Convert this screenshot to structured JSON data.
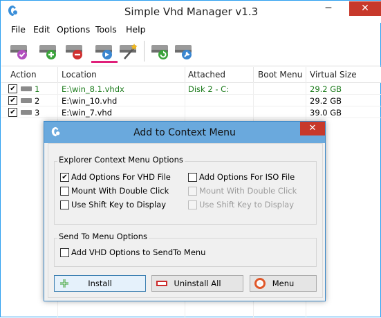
{
  "window": {
    "title": "Simple Vhd Manager v1.3",
    "min_glyph": "─",
    "max_glyph": "☐",
    "close_glyph": "✕"
  },
  "menu": [
    "File",
    "Edit",
    "Options",
    "Tools",
    "Help"
  ],
  "toolbar": {
    "buttons": [
      "mount-vhd",
      "add-vhd",
      "remove-vhd",
      "context-menu",
      "settings-wizard",
      "refresh",
      "tools"
    ],
    "active": "context-menu"
  },
  "list": {
    "columns": [
      "Action",
      "Location",
      "Attached",
      "Boot Menu",
      "Virtual Size"
    ],
    "rows": [
      {
        "num": "1",
        "location": "E:\\win_8.1.vhdx",
        "attached": "Disk 2  -  C:",
        "boot": "",
        "size": "29.2 GB",
        "checked": true,
        "highlight": true
      },
      {
        "num": "2",
        "location": "E:\\win_10.vhd",
        "attached": "",
        "boot": "",
        "size": "29.2 GB",
        "checked": true,
        "highlight": false
      },
      {
        "num": "3",
        "location": "E:\\win_7.vhd",
        "attached": "",
        "boot": "",
        "size": "39.0 GB",
        "checked": true,
        "highlight": false
      }
    ]
  },
  "dialog": {
    "title": "Add to Context Menu",
    "close_glyph": "✕",
    "explorer_group": {
      "title": "Explorer Context Menu Options",
      "vhd": [
        {
          "label": "Add Options For VHD File",
          "checked": true,
          "enabled": true
        },
        {
          "label": "Mount With Double Click",
          "checked": false,
          "enabled": true
        },
        {
          "label": "Use Shift Key to Display",
          "checked": false,
          "enabled": true
        }
      ],
      "iso": [
        {
          "label": "Add Options For ISO File",
          "checked": false,
          "enabled": true
        },
        {
          "label": "Mount With Double Click",
          "checked": false,
          "enabled": false
        },
        {
          "label": "Use Shift Key to Display",
          "checked": false,
          "enabled": false
        }
      ]
    },
    "sendto_group": {
      "title": "Send To Menu Options",
      "option": {
        "label": "Add VHD Options to SendTo Menu",
        "checked": false,
        "enabled": true
      }
    },
    "buttons": {
      "install": "Install",
      "uninstall": "Uninstall All",
      "menu": "Menu"
    }
  },
  "check_glyph": "✔",
  "colors": {
    "accent": "#2b9ff0",
    "dialog_title": "#6aa9dd",
    "close": "#c7392b",
    "attached_text": "#1a7a1a",
    "active_tool": "#e0207a"
  }
}
